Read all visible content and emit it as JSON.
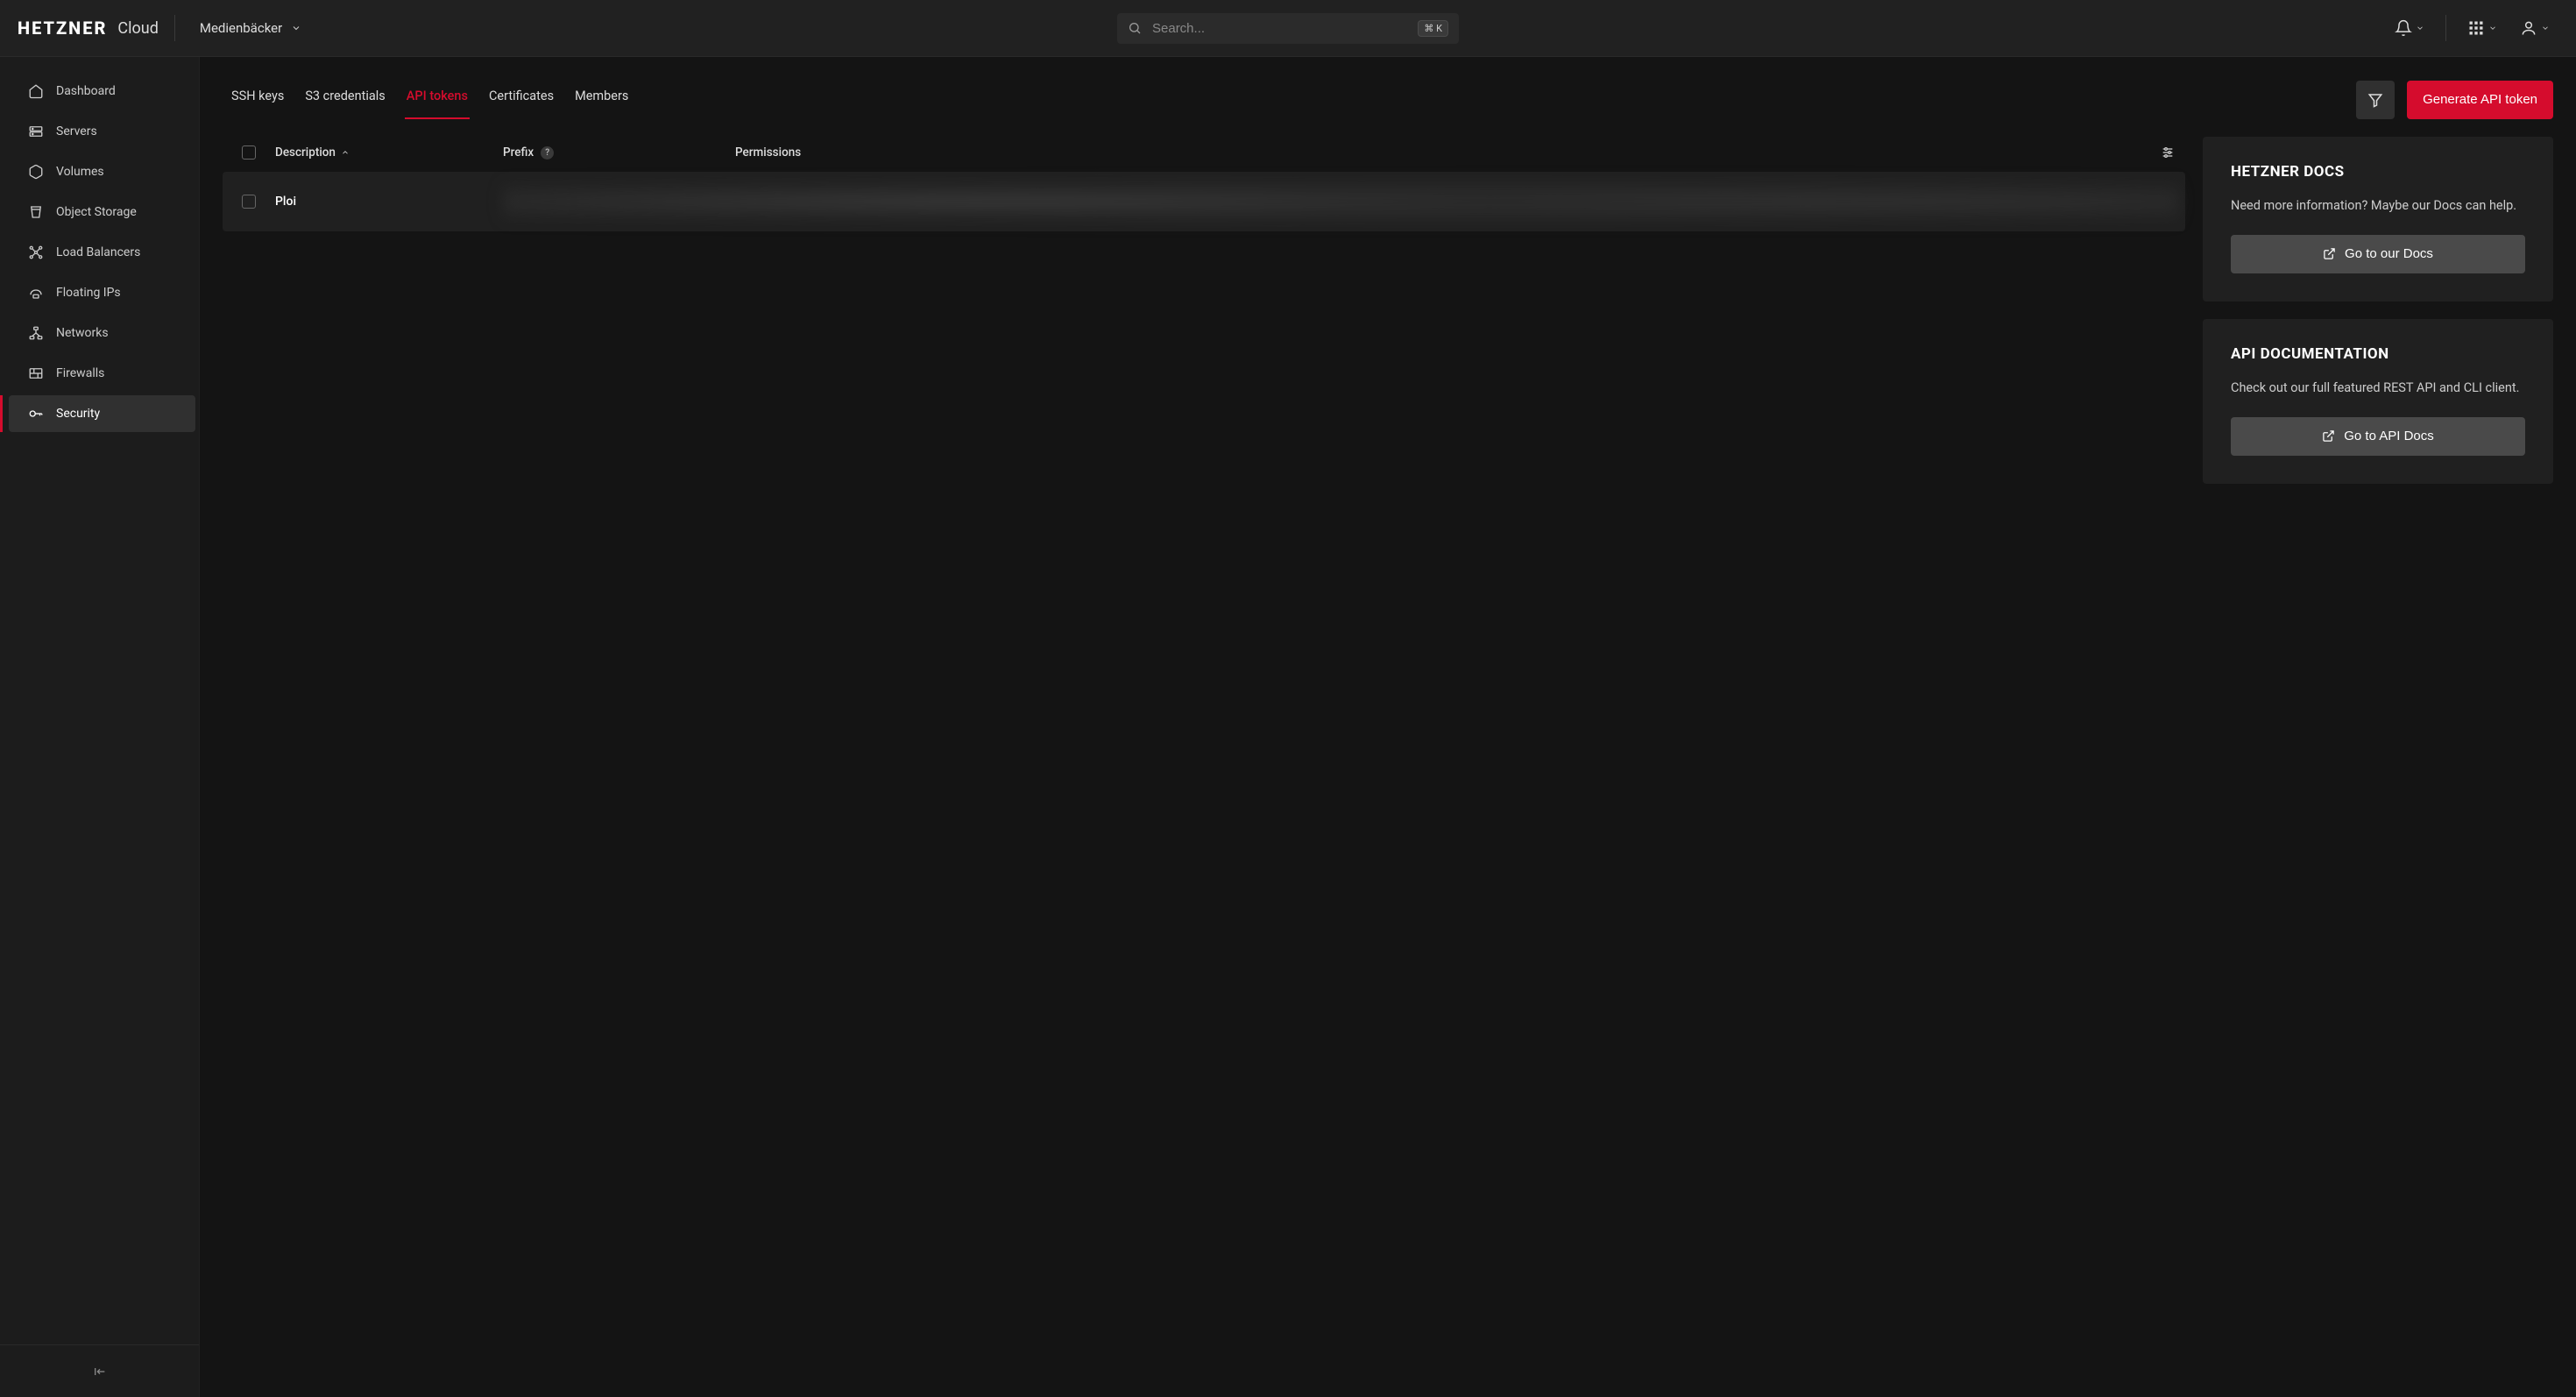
{
  "brand": {
    "name": "HETZNER",
    "product": "Cloud"
  },
  "project": {
    "name": "Medienbäcker"
  },
  "search": {
    "placeholder": "Search...",
    "shortcut": "⌘ K"
  },
  "sidebar": {
    "items": [
      {
        "label": "Dashboard",
        "icon": "home"
      },
      {
        "label": "Servers",
        "icon": "server"
      },
      {
        "label": "Volumes",
        "icon": "volume"
      },
      {
        "label": "Object Storage",
        "icon": "bucket"
      },
      {
        "label": "Load Balancers",
        "icon": "loadbalancer"
      },
      {
        "label": "Floating IPs",
        "icon": "floating-ip"
      },
      {
        "label": "Networks",
        "icon": "network"
      },
      {
        "label": "Firewalls",
        "icon": "firewall"
      },
      {
        "label": "Security",
        "icon": "key",
        "active": true
      }
    ]
  },
  "tabs": [
    {
      "label": "SSH keys"
    },
    {
      "label": "S3 credentials"
    },
    {
      "label": "API tokens",
      "active": true
    },
    {
      "label": "Certificates"
    },
    {
      "label": "Members"
    }
  ],
  "actions": {
    "generate": "Generate API token"
  },
  "table": {
    "columns": {
      "description": "Description",
      "prefix": "Prefix",
      "permissions": "Permissions"
    },
    "rows": [
      {
        "description": "Ploi"
      }
    ]
  },
  "docs_card": {
    "title": "HETZNER DOCS",
    "body": "Need more information? Maybe our Docs can help.",
    "cta": "Go to our Docs"
  },
  "api_card": {
    "title": "API DOCUMENTATION",
    "body": "Check out our full featured REST API and CLI client.",
    "cta": "Go to API Docs"
  }
}
